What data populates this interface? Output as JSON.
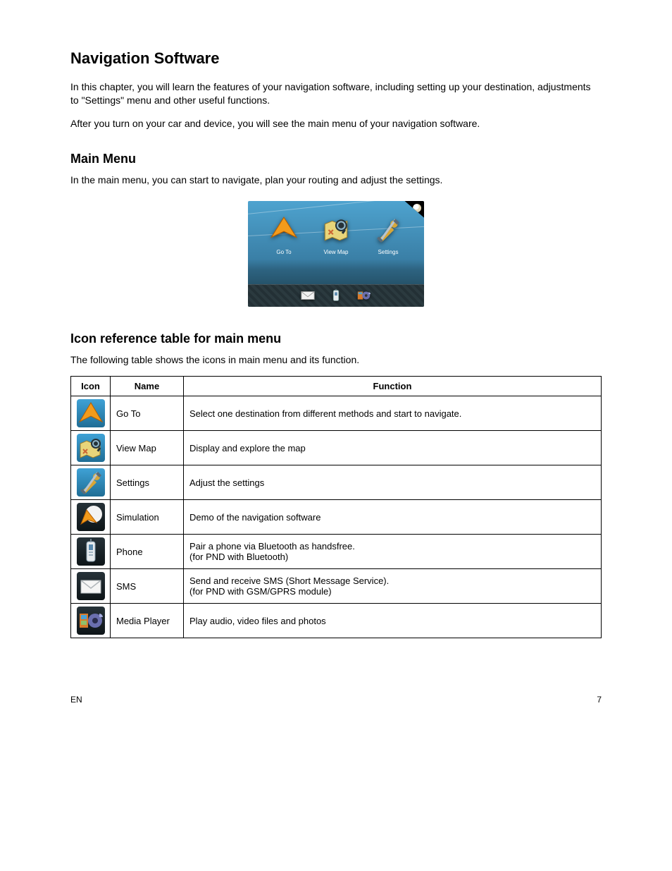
{
  "heading": "Navigation Software",
  "intro1": "In this chapter, you will learn the features of your navigation software, including setting up your destination, adjustments to \"Settings\" menu and other useful functions.",
  "intro2": "After you turn on your car and device, you will see the main menu of your navigation software.",
  "sub1": "Main Menu",
  "sub1_text": "In the main menu, you can start to navigate, plan your routing and adjust the settings.",
  "screenshot": {
    "items": [
      {
        "label": "Go To"
      },
      {
        "label": "View Map"
      },
      {
        "label": "Settings"
      }
    ]
  },
  "sub2": "Icon reference table for main menu",
  "sub2_text": "The following table shows the icons in main menu and its function.",
  "table": {
    "headers": [
      "Icon",
      "Name",
      "Function"
    ],
    "rows": [
      {
        "name": "Go To",
        "func": "Select one destination from different methods and start to navigate."
      },
      {
        "name": "View Map",
        "func": "Display and explore the map"
      },
      {
        "name": "Settings",
        "func": "Adjust the settings"
      },
      {
        "name": "Simulation",
        "func": "Demo of the navigation software"
      },
      {
        "name": "Phone",
        "func": "Pair a phone via Bluetooth as handsfree.\n(for PND with Bluetooth)"
      },
      {
        "name": "SMS",
        "func": "Send and receive SMS (Short Message Service).\n(for PND with GSM/GPRS module)"
      },
      {
        "name": "Media Player",
        "func": "Play audio, video files and photos"
      }
    ]
  },
  "footer_left": "EN",
  "footer_right": "7"
}
